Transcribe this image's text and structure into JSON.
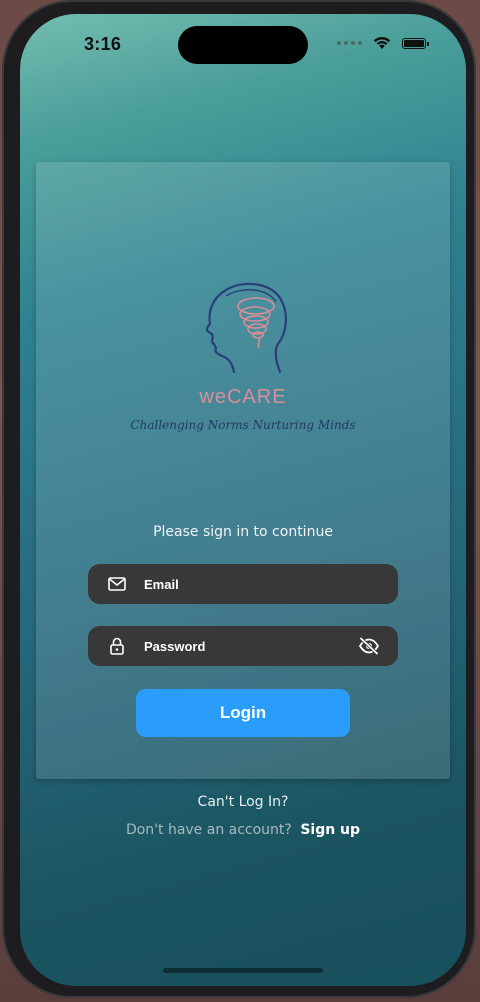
{
  "status_bar": {
    "time": "3:16",
    "icons": [
      "signal-dots-icon",
      "wifi-icon",
      "battery-icon"
    ]
  },
  "brand": {
    "name": "weCARE",
    "tagline": "Challenging Norms Nurturing Minds",
    "logo_icon": "head-brain-spiral-icon",
    "name_color": "#d78f98",
    "tagline_color": "#233a66"
  },
  "login_form": {
    "prompt": "Please sign in to continue",
    "email_placeholder": "Email",
    "password_placeholder": "Password",
    "email_icon": "mail-icon",
    "password_icon": "lock-icon",
    "visibility_icon": "eye-off-icon",
    "login_label": "Login",
    "login_color": "#2a9dfa"
  },
  "footer": {
    "cant_login": "Can't Log In?",
    "no_account": "Don't have an account?",
    "signup_label": "Sign up"
  }
}
